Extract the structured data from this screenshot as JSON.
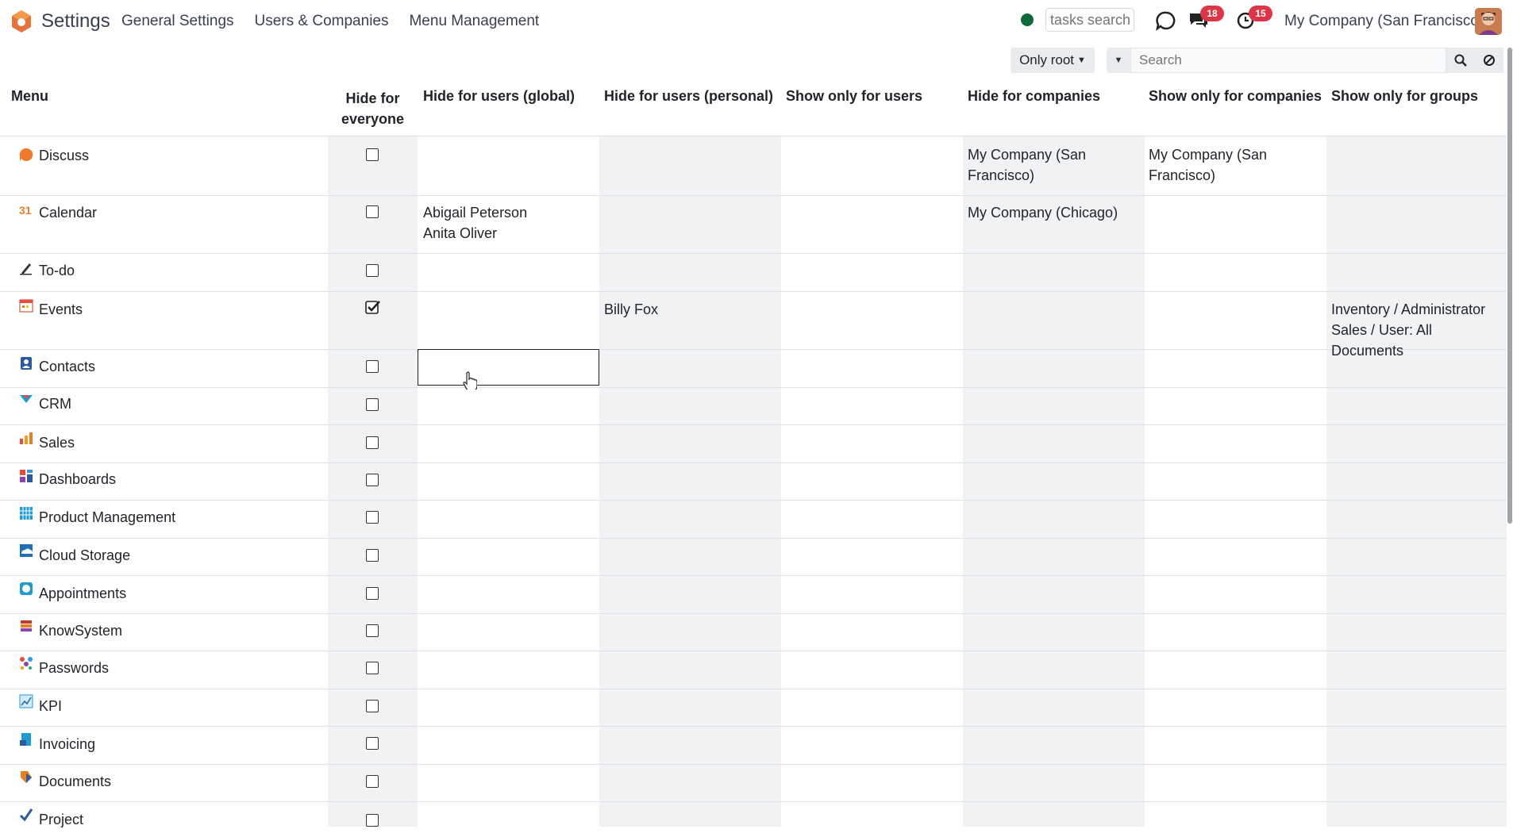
{
  "app": {
    "title": "Settings",
    "nav": [
      "General Settings",
      "Users & Companies",
      "Menu Management"
    ],
    "tasks_search_placeholder": "tasks search",
    "messages_badge": "18",
    "activities_badge": "15",
    "company": "My Company (San Francisco)"
  },
  "controls": {
    "only_root": "Only root",
    "search_placeholder": "Search"
  },
  "table": {
    "headers": {
      "menu": "Menu",
      "hide_everyone_1": "Hide for",
      "hide_everyone_2": "everyone",
      "hide_users_global": "Hide for users (global)",
      "hide_users_personal": "Hide for users (personal)",
      "show_only_users": "Show only for users",
      "hide_companies": "Hide for companies",
      "show_only_companies": "Show only for companies",
      "show_only_groups": "Show only for groups"
    },
    "rows": [
      {
        "menu": "Discuss",
        "icon": "discuss-icon",
        "hidden": false,
        "hide_global": [
          "",
          ""
        ],
        "hide_personal": "",
        "show_users": "",
        "hide_companies": [
          "My Company (San",
          "Francisco)"
        ],
        "show_companies": [
          "My Company (San",
          "Francisco)"
        ],
        "show_groups": [
          "",
          ""
        ]
      },
      {
        "menu": "Calendar",
        "icon": "calendar-icon",
        "hidden": false,
        "hide_global": [
          "Abigail Peterson",
          "Anita Oliver"
        ],
        "hide_personal": "",
        "show_users": "",
        "hide_companies": [
          "My Company (Chicago)",
          ""
        ],
        "show_companies": [
          "",
          ""
        ],
        "show_groups": [
          "",
          ""
        ]
      },
      {
        "menu": "To-do",
        "icon": "todo-icon",
        "hidden": false,
        "hide_global": [
          "",
          ""
        ],
        "hide_personal": "",
        "show_users": "",
        "hide_companies": [
          "",
          ""
        ],
        "show_companies": [
          "",
          ""
        ],
        "show_groups": [
          "",
          ""
        ]
      },
      {
        "menu": "Events",
        "icon": "events-icon",
        "hidden": true,
        "hide_global": [
          "",
          ""
        ],
        "hide_personal": "Billy Fox",
        "show_users": "",
        "hide_companies": [
          "",
          ""
        ],
        "show_companies": [
          "",
          ""
        ],
        "show_groups": [
          "Inventory / Administrator",
          "Sales / User: All Documents"
        ]
      },
      {
        "menu": "Contacts",
        "icon": "contacts-icon",
        "hidden": false
      },
      {
        "menu": "CRM",
        "icon": "crm-icon",
        "hidden": false
      },
      {
        "menu": "Sales",
        "icon": "sales-icon",
        "hidden": false
      },
      {
        "menu": "Dashboards",
        "icon": "dashboards-icon",
        "hidden": false
      },
      {
        "menu": "Product Management",
        "icon": "product-management-icon",
        "hidden": false
      },
      {
        "menu": "Cloud Storage",
        "icon": "cloud-storage-icon",
        "hidden": false
      },
      {
        "menu": "Appointments",
        "icon": "appointments-icon",
        "hidden": false
      },
      {
        "menu": "KnowSystem",
        "icon": "knowsystem-icon",
        "hidden": false
      },
      {
        "menu": "Passwords",
        "icon": "passwords-icon",
        "hidden": false
      },
      {
        "menu": "KPI",
        "icon": "kpi-icon",
        "hidden": false
      },
      {
        "menu": "Invoicing",
        "icon": "invoicing-icon",
        "hidden": false
      },
      {
        "menu": "Documents",
        "icon": "documents-icon",
        "hidden": false
      },
      {
        "menu": "Project",
        "icon": "project-icon",
        "hidden": false
      }
    ]
  }
}
